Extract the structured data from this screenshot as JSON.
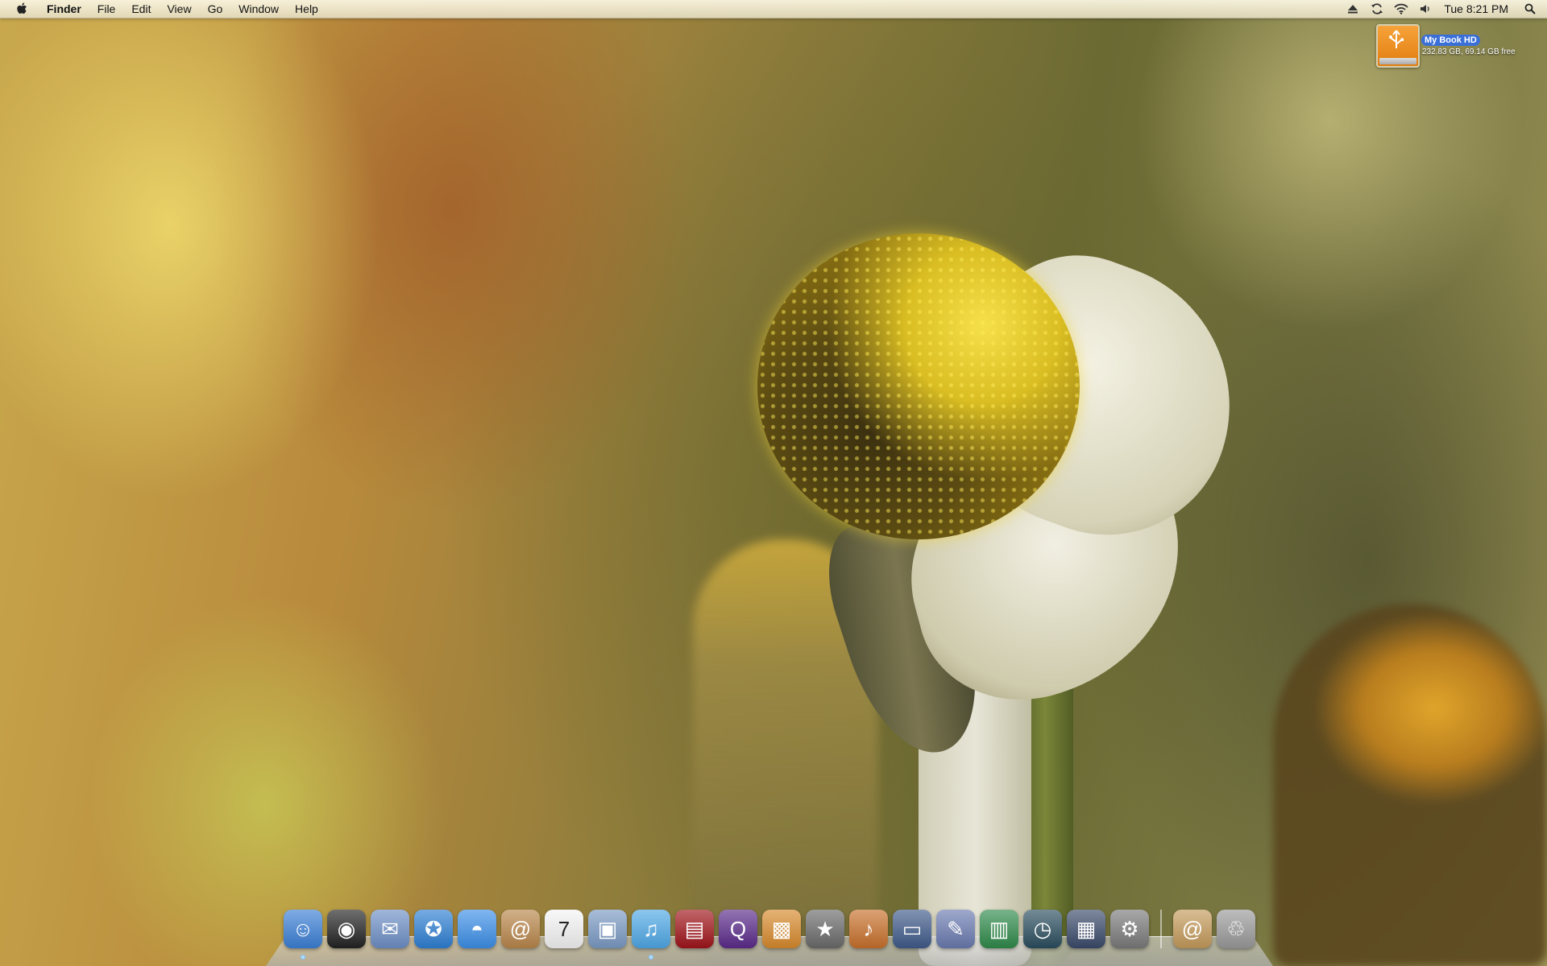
{
  "menubar": {
    "apple_icon": "apple-logo-icon",
    "app_name": "Finder",
    "menus": [
      "File",
      "Edit",
      "View",
      "Go",
      "Window",
      "Help"
    ],
    "status_icons": [
      "eject-icon",
      "sync-icon",
      "wifi-icon",
      "volume-icon"
    ],
    "clock": "Tue 8:21 PM",
    "spotlight_icon": "spotlight-search-icon"
  },
  "desktop": {
    "drive": {
      "icon": "external-drive-icon",
      "name": "My Book HD",
      "info": "232.83 GB, 69.14 GB free"
    }
  },
  "dock": {
    "items": [
      {
        "name": "finder-icon",
        "glyph": "☺",
        "color": "#3b7fd6"
      },
      {
        "name": "dashboard-icon",
        "glyph": "◉",
        "color": "#222222"
      },
      {
        "name": "mail-icon",
        "glyph": "✉",
        "color": "#6d8fc6"
      },
      {
        "name": "safari-icon",
        "glyph": "✪",
        "color": "#2d7fd3"
      },
      {
        "name": "ichat-icon",
        "glyph": "◓",
        "color": "#3c8fe8"
      },
      {
        "name": "address-book-icon",
        "glyph": "@",
        "color": "#b9864a"
      },
      {
        "name": "ical-icon",
        "glyph": "7",
        "color": "#f4f4f4"
      },
      {
        "name": "preview-icon",
        "glyph": "▣",
        "color": "#7a9ac4"
      },
      {
        "name": "itunes-icon",
        "glyph": "♫",
        "color": "#4ea8e6"
      },
      {
        "name": "front-row-icon",
        "glyph": "▤",
        "color": "#a0141a"
      },
      {
        "name": "quicktime-icon",
        "glyph": "Q",
        "color": "#5a2a8a"
      },
      {
        "name": "iphoto-icon",
        "glyph": "▩",
        "color": "#d88a2c"
      },
      {
        "name": "imovie-icon",
        "glyph": "★",
        "color": "#6a6a6a"
      },
      {
        "name": "garageband-icon",
        "glyph": "♪",
        "color": "#c8702a"
      },
      {
        "name": "keynote-icon",
        "glyph": "▭",
        "color": "#3f5a8a"
      },
      {
        "name": "pages-icon",
        "glyph": "✎",
        "color": "#6a7ab0"
      },
      {
        "name": "numbers-icon",
        "glyph": "▥",
        "color": "#2f8a4a"
      },
      {
        "name": "time-machine-icon",
        "glyph": "◷",
        "color": "#2a4d5e"
      },
      {
        "name": "spaces-icon",
        "glyph": "▦",
        "color": "#3a4a6a"
      },
      {
        "name": "system-preferences-icon",
        "glyph": "⚙",
        "color": "#7a7a7a"
      }
    ],
    "right_items": [
      {
        "name": "documents-stack-icon",
        "glyph": "@",
        "color": "#c49a5a"
      },
      {
        "name": "trash-icon",
        "glyph": "♲",
        "color": "#9a9a9a"
      }
    ],
    "running": [
      "finder-icon",
      "itunes-icon"
    ]
  }
}
